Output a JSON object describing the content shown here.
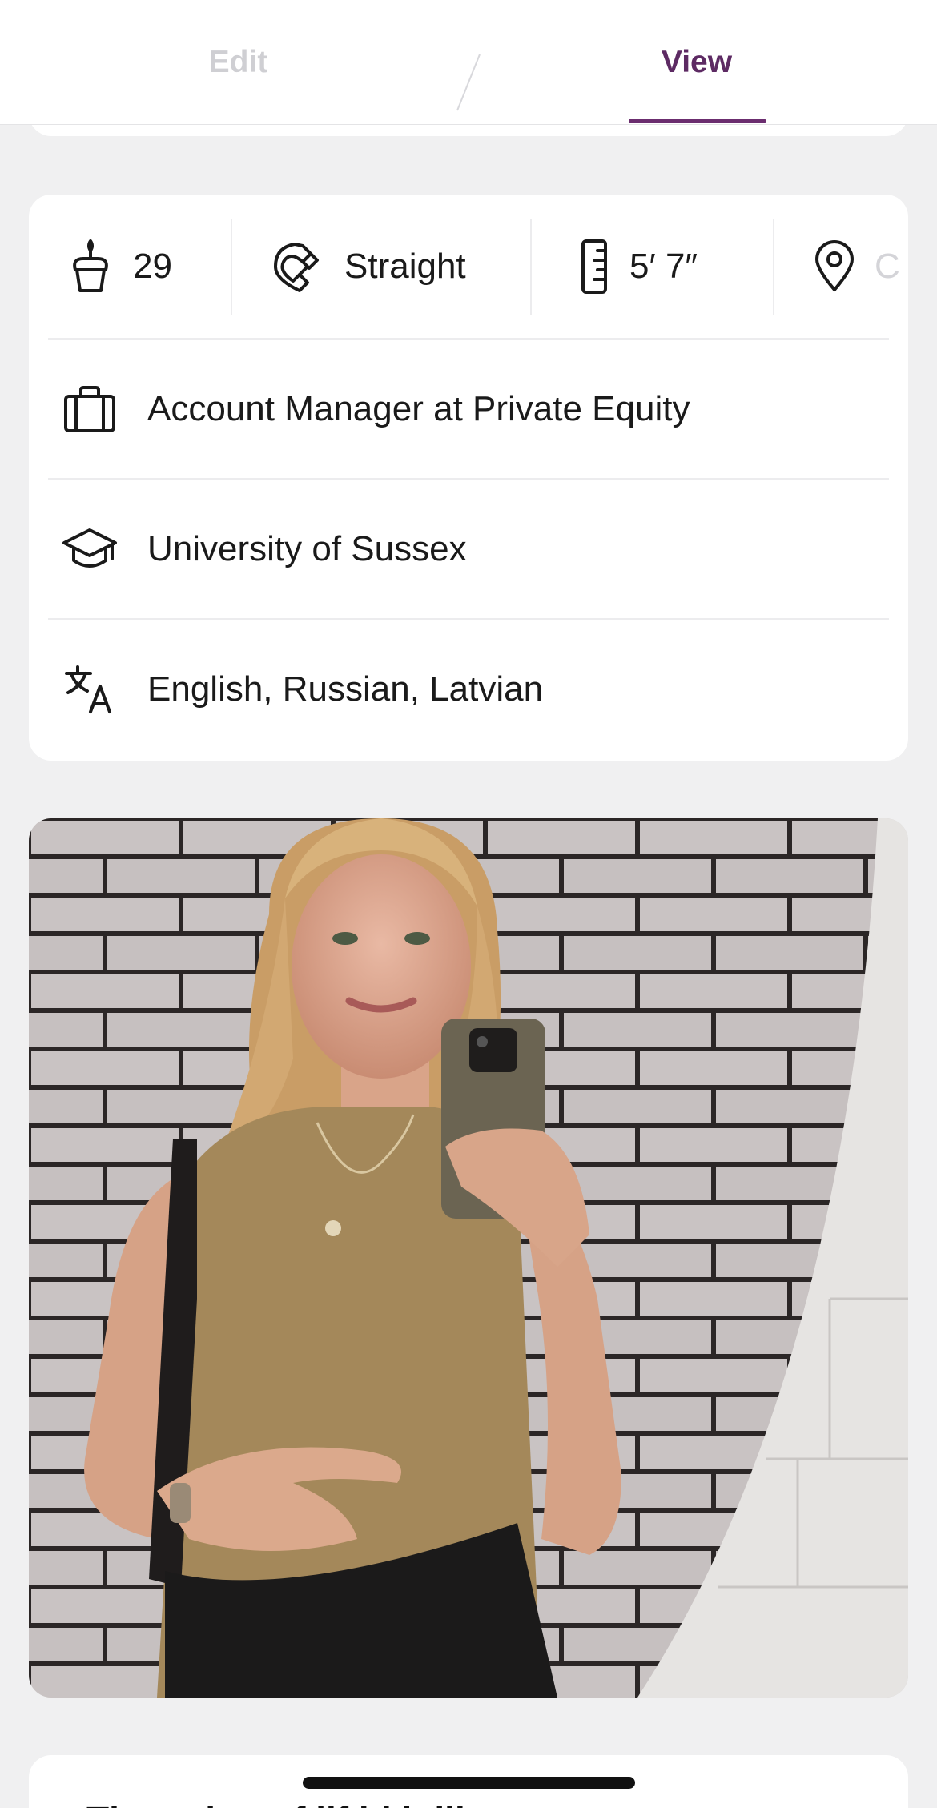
{
  "header": {
    "tabs": [
      {
        "label": "Edit",
        "active": false
      },
      {
        "label": "View",
        "active": true
      }
    ],
    "accent_color": "#6b2d6f"
  },
  "vitals": [
    {
      "icon": "cake-icon",
      "value": "29"
    },
    {
      "icon": "magnet-icon",
      "value": "Straight"
    },
    {
      "icon": "ruler-icon",
      "value": "5′ 7″"
    },
    {
      "icon": "location-pin-icon",
      "value": "C"
    }
  ],
  "details": [
    {
      "icon": "briefcase-icon",
      "value": "Account Manager at Private Equity"
    },
    {
      "icon": "graduation-cap-icon",
      "value": "University of Sussex"
    },
    {
      "icon": "translate-icon",
      "value": "English, Russian, Latvian"
    }
  ],
  "next_prompt": {
    "text": "The a  tion  t f   lif    ld b   lik"
  }
}
